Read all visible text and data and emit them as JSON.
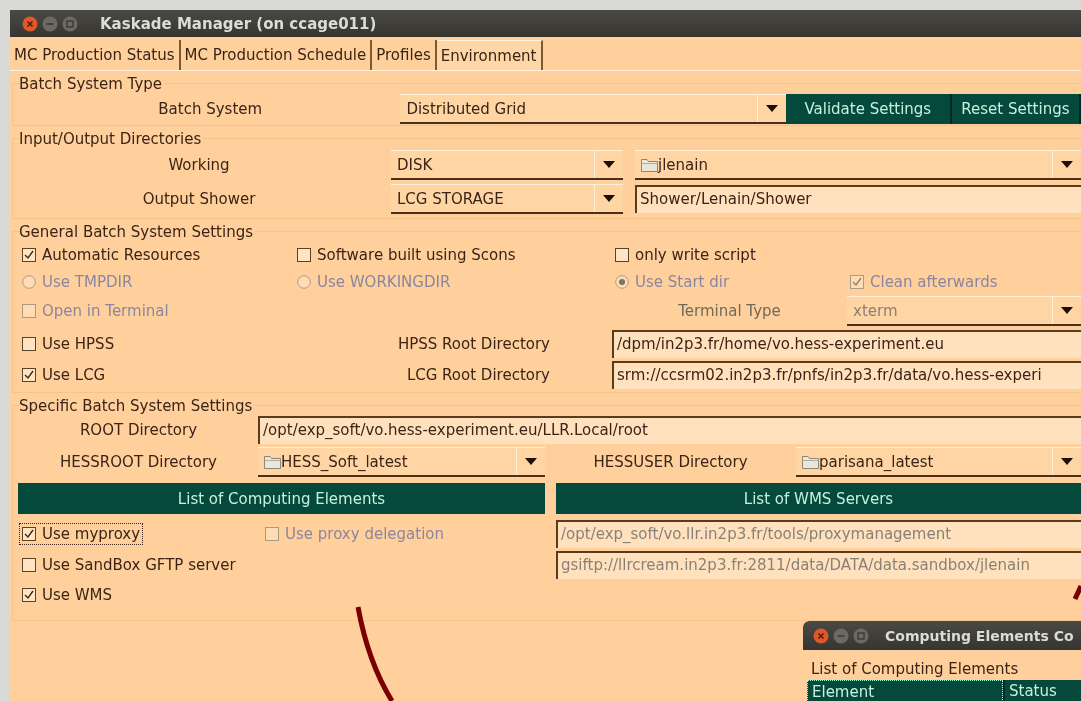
{
  "window": {
    "title": "Kaskade Manager (on ccage011)"
  },
  "tabs": [
    {
      "label": "MC Production Status",
      "selected": false
    },
    {
      "label": "MC Production Schedule",
      "selected": false
    },
    {
      "label": "Profiles",
      "selected": false
    },
    {
      "label": "Environment",
      "selected": true
    }
  ],
  "batch_system_type": {
    "title": "Batch System Type",
    "label": "Batch System",
    "combo": {
      "value": "Distributed Grid"
    },
    "buttons": [
      "Validate Settings",
      "Reset Settings"
    ]
  },
  "io_directories": {
    "title": "Input/Output Directories",
    "rows": [
      {
        "label": "Working",
        "storage": "DISK",
        "path": {
          "kind": "folder_combo",
          "value": "jlenain"
        }
      },
      {
        "label": "Output Shower",
        "storage": "LCG STORAGE",
        "path": {
          "kind": "field",
          "value": "Shower/Lenain/Shower"
        }
      }
    ]
  },
  "general_settings": {
    "title": "General Batch System Settings",
    "rows": [
      [
        {
          "kind": "checkbox",
          "label": "Automatic Resources",
          "checked": true,
          "disabled": false
        },
        {
          "kind": "checkbox",
          "label": "Software built using Scons",
          "checked": false,
          "disabled": false
        },
        {
          "kind": "checkbox",
          "label": "only write script",
          "checked": false,
          "disabled": false
        }
      ],
      [
        {
          "kind": "radio",
          "label": "Use TMPDIR",
          "selected": false,
          "disabled": true
        },
        {
          "kind": "radio",
          "label": "Use WORKINGDIR",
          "selected": false,
          "disabled": true
        },
        {
          "kind": "radio",
          "label": "Use Start dir",
          "selected": true,
          "disabled": true
        },
        {
          "kind": "checkbox",
          "label": "Clean afterwards",
          "checked": true,
          "disabled": true
        }
      ],
      [
        {
          "kind": "checkbox",
          "label": "Open in Terminal",
          "checked": false,
          "disabled": true
        },
        null,
        {
          "kind": "label",
          "text": "Terminal Type",
          "disabled": true
        },
        {
          "kind": "combo",
          "value": "xterm",
          "disabled": true
        }
      ],
      [
        {
          "kind": "checkbox",
          "label": "Use HPSS",
          "checked": false,
          "disabled": false
        },
        {
          "kind": "label",
          "text": "HPSS Root Directory",
          "disabled": false
        },
        {
          "kind": "field",
          "value": "/dpm/in2p3.fr/home/vo.hess-experiment.eu",
          "disabled": false
        }
      ],
      [
        {
          "kind": "checkbox",
          "label": "Use LCG",
          "checked": true,
          "disabled": false
        },
        {
          "kind": "label",
          "text": "LCG Root Directory",
          "disabled": false
        },
        {
          "kind": "field",
          "value": "srm://ccsrm02.in2p3.fr/pnfs/in2p3.fr/data/vo.hess-experi",
          "disabled": false
        }
      ]
    ]
  },
  "specific_settings": {
    "title": "Specific Batch System Settings",
    "rows": [
      [
        {
          "kind": "label",
          "text": "ROOT Directory",
          "disabled": false
        },
        {
          "kind": "field",
          "value": "/opt/exp_soft/vo.hess-experiment.eu/LLR.Local/root",
          "disabled": false
        }
      ],
      [
        {
          "kind": "label",
          "text": "HESSROOT Directory",
          "disabled": false
        },
        {
          "kind": "folder_combo",
          "value": "HESS_Soft_latest",
          "disabled": false
        },
        {
          "kind": "label",
          "text": "HESSUSER Directory",
          "disabled": false
        },
        {
          "kind": "folder_combo",
          "value": "parisana_latest",
          "disabled": false
        }
      ]
    ],
    "list_buttons": [
      "List of Computing Elements",
      "List of WMS Servers"
    ],
    "options": [
      [
        {
          "kind": "checkbox",
          "label": "Use myproxy",
          "checked": true,
          "disabled": false,
          "focused": true
        },
        {
          "kind": "checkbox",
          "label": "Use proxy delegation",
          "checked": false,
          "disabled": true
        },
        {
          "kind": "field",
          "value": "/opt/exp_soft/vo.llr.in2p3.fr/tools/proxymanagement",
          "disabled": true
        }
      ],
      [
        {
          "kind": "checkbox",
          "label": "Use SandBox GFTP server",
          "checked": false,
          "disabled": false
        },
        {
          "kind": "field",
          "value": "gsiftp://llrcream.in2p3.fr:2811/data/DATA/data.sandbox/jlenain",
          "disabled": true
        }
      ],
      [
        {
          "kind": "checkbox",
          "label": "Use WMS",
          "checked": true,
          "disabled": false
        }
      ]
    ]
  },
  "sub_window": {
    "title": "Computing Elements Co",
    "group": "List of Computing Elements",
    "columns": [
      "Element",
      "Status"
    ]
  }
}
